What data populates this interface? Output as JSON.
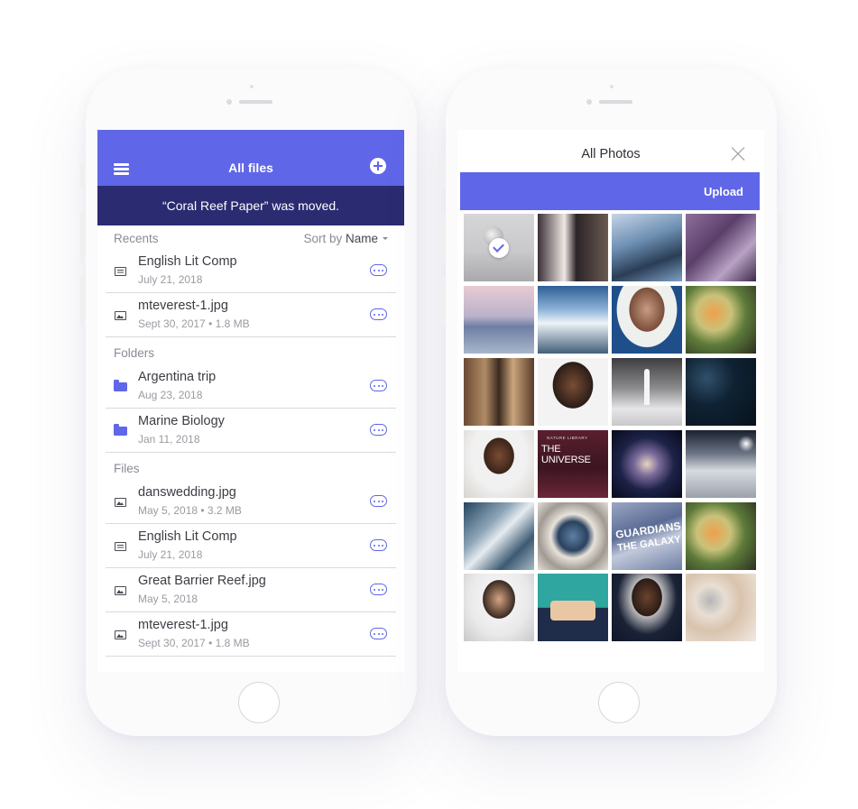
{
  "left_screen": {
    "header": {
      "title": "All files"
    },
    "toast": "“Coral Reef Paper” was moved.",
    "recents": {
      "label": "Recents",
      "sort_label": "Sort by",
      "sort_value": "Name",
      "items": [
        {
          "name": "English Lit Comp",
          "meta": "July 21, 2018",
          "icon": "document-icon"
        },
        {
          "name": "mteverest-1.jpg",
          "meta": "Sept 30, 2017 • 1.8 MB",
          "icon": "image-icon"
        }
      ]
    },
    "folders": {
      "label": "Folders",
      "items": [
        {
          "name": "Argentina trip",
          "meta": "Aug 23, 2018",
          "icon": "folder-icon"
        },
        {
          "name": "Marine Biology",
          "meta": "Jan 11, 2018",
          "icon": "folder-icon"
        }
      ]
    },
    "files": {
      "label": "Files",
      "items": [
        {
          "name": "danswedding.jpg",
          "meta": "May 5, 2018 • 3.2 MB",
          "icon": "image-icon"
        },
        {
          "name": "English Lit Comp",
          "meta": "July 21, 2018",
          "icon": "document-icon"
        },
        {
          "name": "Great Barrier Reef.jpg",
          "meta": "May 5, 2018",
          "icon": "image-icon"
        },
        {
          "name": "mteverest-1.jpg",
          "meta": "Sept 30, 2017 • 1.8 MB",
          "icon": "image-icon"
        }
      ]
    }
  },
  "right_screen": {
    "title": "All Photos",
    "upload_label": "Upload",
    "photo_overlays": {
      "book_title": "THE UNIVERSE",
      "book_publisher": "NATURE LIBRARY",
      "poster_line1": "GUARDIANS",
      "poster_line2": "THE GALAXY"
    },
    "photos": [
      {
        "subject": "moon over landscape",
        "selected": true
      },
      {
        "subject": "wedding couple",
        "selected": false
      },
      {
        "subject": "glass skyscraper",
        "selected": false
      },
      {
        "subject": "couple portrait",
        "selected": false
      },
      {
        "subject": "domed building at lake",
        "selected": false
      },
      {
        "subject": "snowy mountain",
        "selected": false
      },
      {
        "subject": "woman portrait",
        "selected": false
      },
      {
        "subject": "pasta dish",
        "selected": false
      },
      {
        "subject": "old map",
        "selected": false
      },
      {
        "subject": "woman with glasses",
        "selected": false
      },
      {
        "subject": "rocket launch",
        "selected": false
      },
      {
        "subject": "starry sky",
        "selected": false
      },
      {
        "subject": "man portrait",
        "selected": false
      },
      {
        "subject": "book cover",
        "selected": false
      },
      {
        "subject": "galaxy",
        "selected": false
      },
      {
        "subject": "clouds from above",
        "selected": false
      },
      {
        "subject": "earth from orbit",
        "selected": false
      },
      {
        "subject": "astronaut helmet",
        "selected": false
      },
      {
        "subject": "movie poster",
        "selected": false
      },
      {
        "subject": "pasta dish",
        "selected": false
      },
      {
        "subject": "smiling man",
        "selected": false
      },
      {
        "subject": "hands on keyboard illustration",
        "selected": false
      },
      {
        "subject": "man in suit",
        "selected": false
      },
      {
        "subject": "makeup palette",
        "selected": false
      }
    ]
  },
  "colors": {
    "accent": "#5f66e8",
    "toast_bg": "#2b2b72",
    "text_primary": "#3c3c44",
    "text_secondary": "#9a9aa2"
  }
}
